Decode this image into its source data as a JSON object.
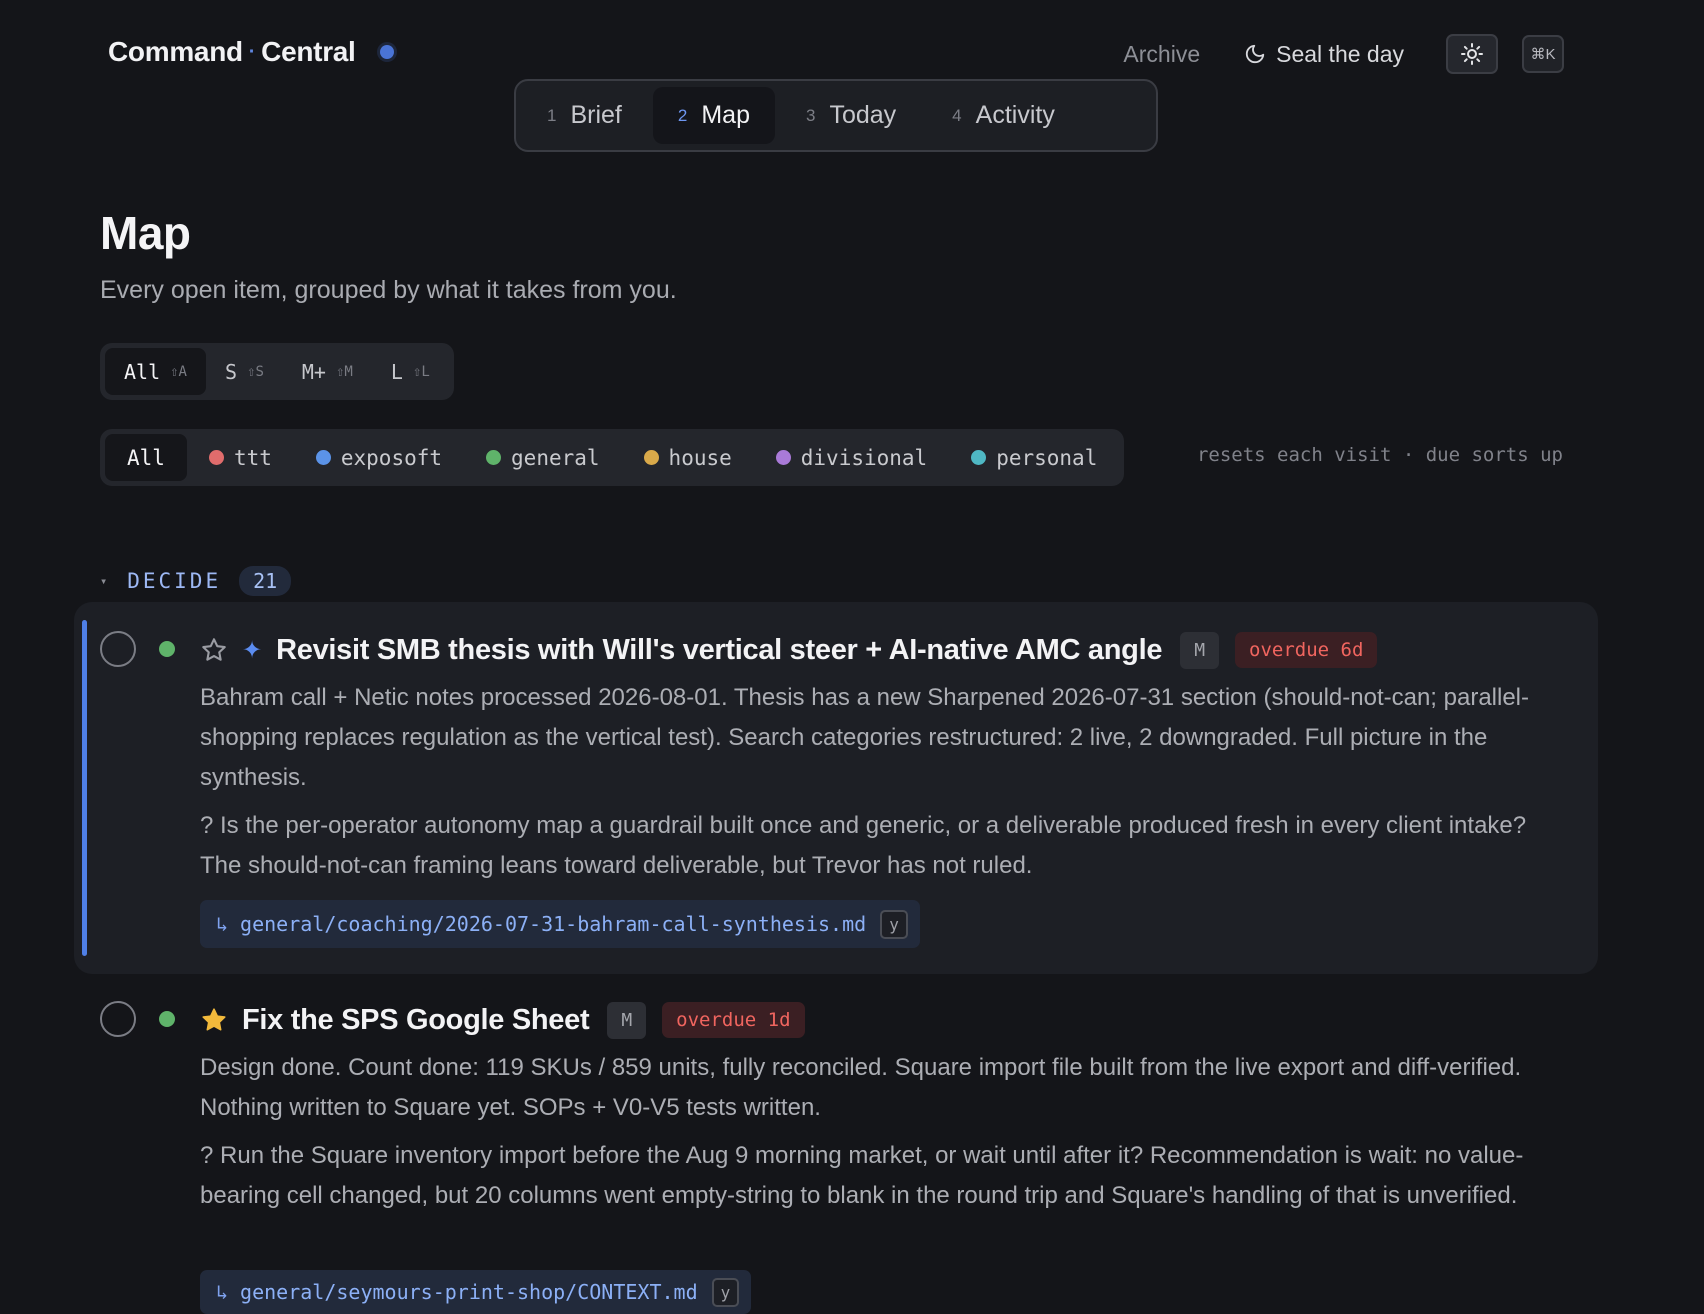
{
  "header": {
    "brand_left": "Command",
    "brand_sep": "·",
    "brand_right": "Central",
    "archive_label": "Archive",
    "seal_label": "Seal the day",
    "command_shortcut": "⌘K"
  },
  "tabs": [
    {
      "num": "1",
      "label": "Brief",
      "active": false
    },
    {
      "num": "2",
      "label": "Map",
      "active": true
    },
    {
      "num": "3",
      "label": "Today",
      "active": false
    },
    {
      "num": "4",
      "label": "Activity",
      "active": false
    }
  ],
  "page": {
    "title": "Map",
    "subtitle": "Every open item, grouped by what it takes from you."
  },
  "size_filter": [
    {
      "label": "All",
      "hint": "⇧A",
      "active": true
    },
    {
      "label": "S",
      "hint": "⇧S",
      "active": false
    },
    {
      "label": "M+",
      "hint": "⇧M",
      "active": false
    },
    {
      "label": "L",
      "hint": "⇧L",
      "active": false
    }
  ],
  "project_filter": [
    {
      "label": "All",
      "color": "",
      "active": true
    },
    {
      "label": "ttt",
      "color": "#e06c6c"
    },
    {
      "label": "exposoft",
      "color": "#5b93e8"
    },
    {
      "label": "general",
      "color": "#5fb36a"
    },
    {
      "label": "house",
      "color": "#d9a94a"
    },
    {
      "label": "divisional",
      "color": "#a97ad8"
    },
    {
      "label": "personal",
      "color": "#4fb8c4"
    }
  ],
  "filter_note": "resets each visit · due sorts up",
  "section": {
    "caret": "▾",
    "title": "DECIDE",
    "count": "21"
  },
  "items": [
    {
      "title": "Revisit SMB thesis with Will's vertical steer + AI-native AMC angle",
      "size": "M",
      "overdue": "overdue 6d",
      "starred": false,
      "description": "Bahram call + Netic notes processed 2026-08-01. Thesis has a new Sharpened 2026-07-31 section (should-not-can; parallel-shopping replaces regulation as the vertical test). Search categories restructured: 2 live, 2 downgraded. Full picture in the synthesis.",
      "question": "? Is the per-operator autonomy map a guardrail built once and generic, or a deliverable produced fresh in every client intake? The should-not-can framing leans toward deliverable, but Trevor has not ruled.",
      "path_arrow": "↳",
      "path": "general/coaching/2026-07-31-bahram-call-synthesis.md",
      "path_key": "y"
    },
    {
      "title": "Fix the SPS Google Sheet",
      "size": "M",
      "overdue": "overdue 1d",
      "starred": true,
      "description": "Design done. Count done: 119 SKUs / 859 units, fully reconciled. Square import file built from the live export and diff-verified. Nothing written to Square yet. SOPs + V0-V5 tests written.",
      "question": "? Run the Square inventory import before the Aug 9 morning market, or wait until after it? Recommendation is wait: no value-bearing cell changed, but 20 columns went empty-string to blank in the round trip and Square's handling of that is unverified.",
      "path_arrow": "↳",
      "path": "general/seymours-print-shop/CONTEXT.md",
      "path_key": "y"
    }
  ],
  "colors": {
    "accent": "#4f7fe6",
    "overdue": "#f0655f",
    "star": "#f2b93b",
    "status_dot": "#5fb36a"
  }
}
